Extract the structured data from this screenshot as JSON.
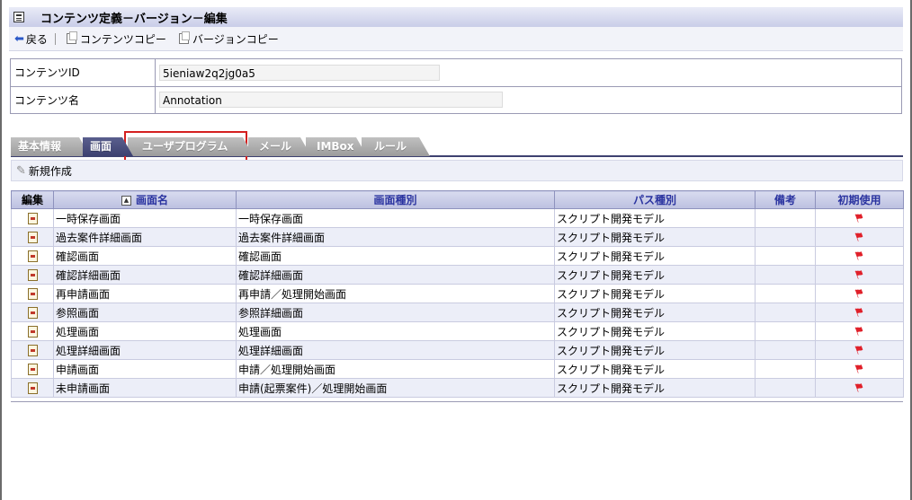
{
  "titlebar": {
    "title": "コンテンツ定義－バージョン－編集"
  },
  "toolbar": {
    "back_label": "戻る",
    "content_copy_label": "コンテンツコピー",
    "version_copy_label": "バージョンコピー"
  },
  "info": {
    "content_id_label": "コンテンツID",
    "content_id_value": "5ieniaw2q2jg0a5",
    "content_name_label": "コンテンツ名",
    "content_name_value": "Annotation"
  },
  "tabs": [
    {
      "label": "基本情報"
    },
    {
      "label": "画面",
      "active": true
    },
    {
      "label": "ユーザプログラム"
    },
    {
      "label": "メール"
    },
    {
      "label": "IMBox"
    },
    {
      "label": "ルール"
    }
  ],
  "actions": {
    "new_label": "新規作成"
  },
  "table": {
    "headers": {
      "edit": "編集",
      "screen_name": "画面名",
      "screen_type": "画面種別",
      "path_type": "パス種別",
      "note": "備考",
      "initial_use": "初期使用"
    },
    "rows": [
      {
        "name": "一時保存画面",
        "type": "一時保存画面",
        "path": "スクリプト開発モデル",
        "note": ""
      },
      {
        "name": "過去案件詳細画面",
        "type": "過去案件詳細画面",
        "path": "スクリプト開発モデル",
        "note": ""
      },
      {
        "name": "確認画面",
        "type": "確認画面",
        "path": "スクリプト開発モデル",
        "note": ""
      },
      {
        "name": "確認詳細画面",
        "type": "確認詳細画面",
        "path": "スクリプト開発モデル",
        "note": ""
      },
      {
        "name": "再申請画面",
        "type": "再申請／処理開始画面",
        "path": "スクリプト開発モデル",
        "note": ""
      },
      {
        "name": "参照画面",
        "type": "参照詳細画面",
        "path": "スクリプト開発モデル",
        "note": ""
      },
      {
        "name": "処理画面",
        "type": "処理画面",
        "path": "スクリプト開発モデル",
        "note": ""
      },
      {
        "name": "処理詳細画面",
        "type": "処理詳細画面",
        "path": "スクリプト開発モデル",
        "note": ""
      },
      {
        "name": "申請画面",
        "type": "申請／処理開始画面",
        "path": "スクリプト開発モデル",
        "note": ""
      },
      {
        "name": "未申請画面",
        "type": "申請(起票案件)／処理開始画面",
        "path": "スクリプト開発モデル",
        "note": ""
      }
    ]
  },
  "colors": {
    "accent": "#3d4170",
    "highlight": "#d42020",
    "header_text": "#2a33a0"
  }
}
